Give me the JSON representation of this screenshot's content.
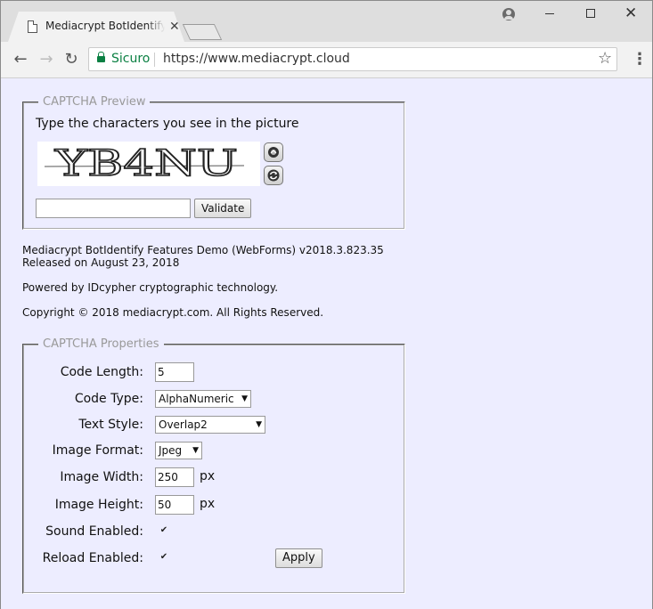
{
  "browser": {
    "tab_title": "Mediacrypt BotIdentify Features Demo",
    "tab_close": "✕",
    "secure_label": "Sicuro",
    "url": "https://www.mediacrypt.cloud",
    "icons": {
      "back": "←",
      "forward": "→",
      "reload": "↻",
      "star": "☆",
      "menu": "⋮",
      "close": "✕"
    }
  },
  "captcha_preview": {
    "legend": "CAPTCHA Preview",
    "instruction": "Type the characters you see in the picture",
    "code": "YB4NU",
    "input_value": "",
    "validate_label": "Validate"
  },
  "info": {
    "version_line": "Mediacrypt BotIdentify Features Demo (WebForms) v2018.3.823.35",
    "released_line": "Released on August 23, 2018",
    "powered_line": "Powered by IDcypher cryptographic technology.",
    "copyright_line": "Copyright © 2018 mediacrypt.com. All Rights Reserved."
  },
  "captcha_properties": {
    "legend": "CAPTCHA Properties",
    "code_length": {
      "label": "Code Length:",
      "value": "5"
    },
    "code_type": {
      "label": "Code Type:",
      "value": "AlphaNumeric"
    },
    "text_style": {
      "label": "Text Style:",
      "value": "Overlap2"
    },
    "image_format": {
      "label": "Image Format:",
      "value": "Jpeg"
    },
    "image_width": {
      "label": "Image Width:",
      "value": "250",
      "unit": "px"
    },
    "image_height": {
      "label": "Image Height:",
      "value": "50",
      "unit": "px"
    },
    "sound_enabled": {
      "label": "Sound Enabled:",
      "checked": true
    },
    "reload_enabled": {
      "label": "Reload Enabled:",
      "checked": true
    },
    "apply_label": "Apply"
  },
  "colors": {
    "page_background": "#ededff",
    "secure_green": "#0b8043",
    "legend_gray": "#999999"
  }
}
